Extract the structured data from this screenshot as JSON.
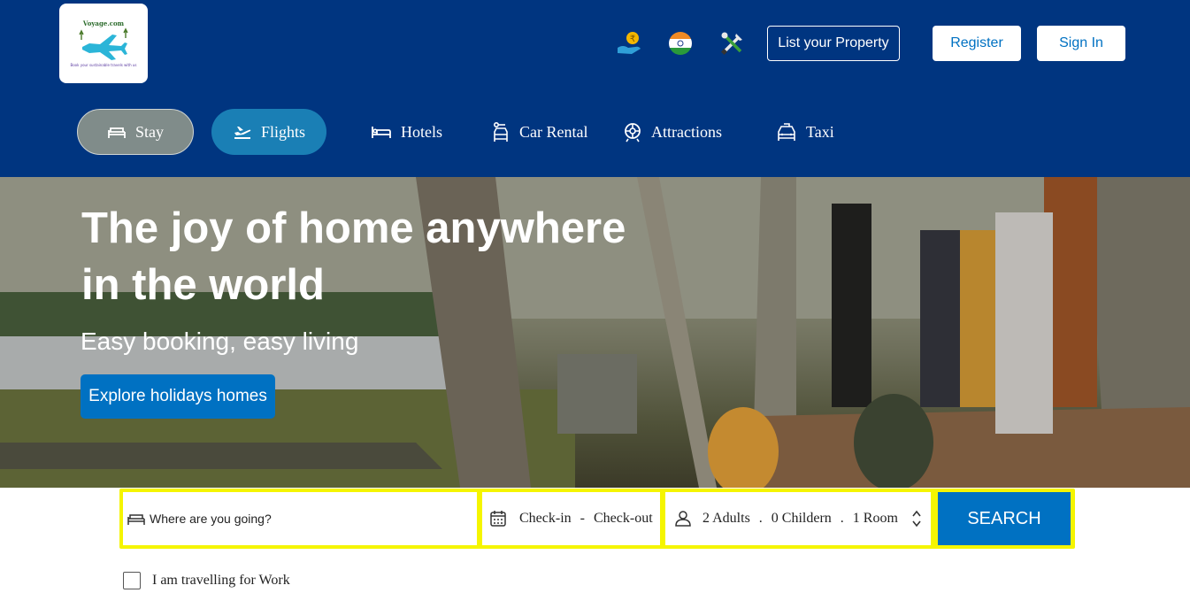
{
  "logo": {
    "brand": "Voyage.com",
    "tagline": "Book your sustainable travels with us"
  },
  "header": {
    "icons": [
      "currency-icon",
      "india-flag-icon",
      "tools-icon"
    ],
    "list_property": "List your Property",
    "register": "Register",
    "sign_in": "Sign In"
  },
  "nav": {
    "items": [
      {
        "label": "Stay",
        "icon": "bed-icon",
        "active": true
      },
      {
        "label": "Flights",
        "icon": "plane-icon",
        "active": true
      },
      {
        "label": "Hotels",
        "icon": "hotel-bed-icon"
      },
      {
        "label": "Car Rental",
        "icon": "car-rental-icon"
      },
      {
        "label": "Attractions",
        "icon": "attractions-icon"
      },
      {
        "label": "Taxi",
        "icon": "taxi-icon"
      }
    ]
  },
  "hero": {
    "title": "The joy of home anywhere in the world",
    "subtitle": "Easy booking, easy living",
    "cta": "Explore holidays homes"
  },
  "search": {
    "destination_placeholder": "Where are you going?",
    "check_in": "Check-in",
    "date_separator": "-",
    "check_out": "Check-out",
    "adults": "2 Adults",
    "children": "0 Childern",
    "rooms": "1 Room",
    "guest_separator": ".",
    "button": "SEARCH"
  },
  "work_checkbox": {
    "label": "I am travelling for Work",
    "checked": false
  },
  "colors": {
    "header_bg": "#003580",
    "primary_blue": "#0071c2",
    "search_border": "#f5f500",
    "stay_pill": "#808c8a",
    "flights_pill": "#1a7fb5"
  }
}
